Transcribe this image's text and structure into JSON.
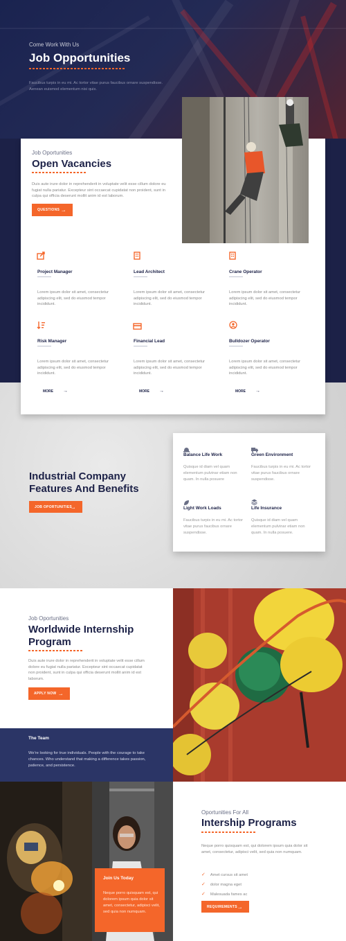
{
  "hero": {
    "kicker": "Come Work With Us",
    "title": "Job Opportunities",
    "text_line1": "Faucibus turpis in eu mi. Ac tortor vitae purus faucibus ornare suspendisse.",
    "text_line2": "Aenean euismod elementum nisi quis."
  },
  "vacancies": {
    "kicker": "Job Oportunities",
    "title": "Open Vacancies",
    "text": "Duis aute irure dolor in reprehenderit in voluptate velit esse cillum dolore eu fugiat nulla pariatur. Excepteur sint occaecat cupidatat non proident, sunt in culpa qui officia deserunt mollit anim id est laborum.",
    "button": "QUESTIONS",
    "photo_alt": "Rope access worker"
  },
  "jobs": [
    {
      "title": "Project Manager",
      "icon": "share-icon",
      "desc": "Lorem ipsum dolor sit amet, consectetur adipiscing elit, sed do eiusmod tempor incididunt."
    },
    {
      "title": "Lead Architect",
      "icon": "building-icon",
      "desc": "Lorem ipsum dolor sit amet, consectetur adipiscing elit, sed do eiusmod tempor incididunt."
    },
    {
      "title": "Crane Operator",
      "icon": "building-icon",
      "desc": "Lorem ipsum dolor sit amet, consectetur adipiscing elit, sed do eiusmod tempor incididunt."
    },
    {
      "title": "Risk Manager",
      "icon": "sort-icon",
      "desc": "Lorem ipsum dolor sit amet, consectetur adipiscing elit, sed do eiusmod tempor incididunt."
    },
    {
      "title": "Financial Lead",
      "icon": "card-icon",
      "desc": "Lorem ipsum dolor sit amet, consectetur adipiscing elit, sed do eiusmod tempor incididunt."
    },
    {
      "title": "Bulldozer Operator",
      "icon": "user-circle-icon",
      "desc": "Lorem ipsum dolor sit amet, consectetur adipiscing elit, sed do eiusmod tempor incididunt."
    }
  ],
  "more_label": "MORE",
  "benefits": {
    "title_line1": "Industrial Company",
    "title_line2": "Features And Benefits",
    "button": "JOB OPORTUNITIES",
    "items": [
      {
        "title": "Balance Life Work",
        "icon": "helmet-icon",
        "desc": "Quisque id diam vel quam elementum pulvinar etiam non quam. In nulla posuere"
      },
      {
        "title": "Green Environment",
        "icon": "truck-icon",
        "desc": "Faucibus turpis in eu mi. Ac tortor vitae purus faucibus ornare suspendisse."
      },
      {
        "title": "Light Work Loads",
        "icon": "leaf-icon",
        "desc": "Faucibus turpis in eu mi. Ac tortor vitae purus faucibus ornare suspendisse."
      },
      {
        "title": "Life Insurance",
        "icon": "layers-icon",
        "desc": "Quisque id diam vel quam elementum pulvinar etiam non quam. In nulla posuere."
      }
    ]
  },
  "internship": {
    "kicker": "Job Oportunities",
    "title_line1": "Worldwide Internship",
    "title_line2": "Program",
    "text": "Duis aute irure dolor in reprehenderit in voluptate velit esse cillum dolore eu fugiat nulla pariatur. Excepteur sint occaecat cupidatat non proident, sunt in culpa qui officia deserunt mollit anim id est laborum.",
    "button": "APPLY NOW"
  },
  "team": {
    "title": "The Team",
    "text": "We're looking for true individuals. People with the courage to take chances. Who understand that making a difference takes passion, patience, and persistence."
  },
  "join": {
    "title": "Join Us Today",
    "text": "Neque porro quisquam est, qui dolorem ipsum quia dolor sit amet, consectetur, adipisci velit, sed quia non numquam."
  },
  "programs": {
    "kicker": "Oportunities For All",
    "title": "Intership Programs",
    "text": "Neque porro quisquam est, qui dolorem ipsum quia dolor sit amet, consectetur, adipisci velit, sed quia non numquam.",
    "list": [
      "Amet cursus sit amet",
      "dolor magna eget",
      "Malesuada fames ac"
    ],
    "button": "REQUIREMENTS"
  },
  "colors": {
    "accent": "#f4662a",
    "navy": "#1c2147",
    "team_blue": "#2b3566"
  }
}
